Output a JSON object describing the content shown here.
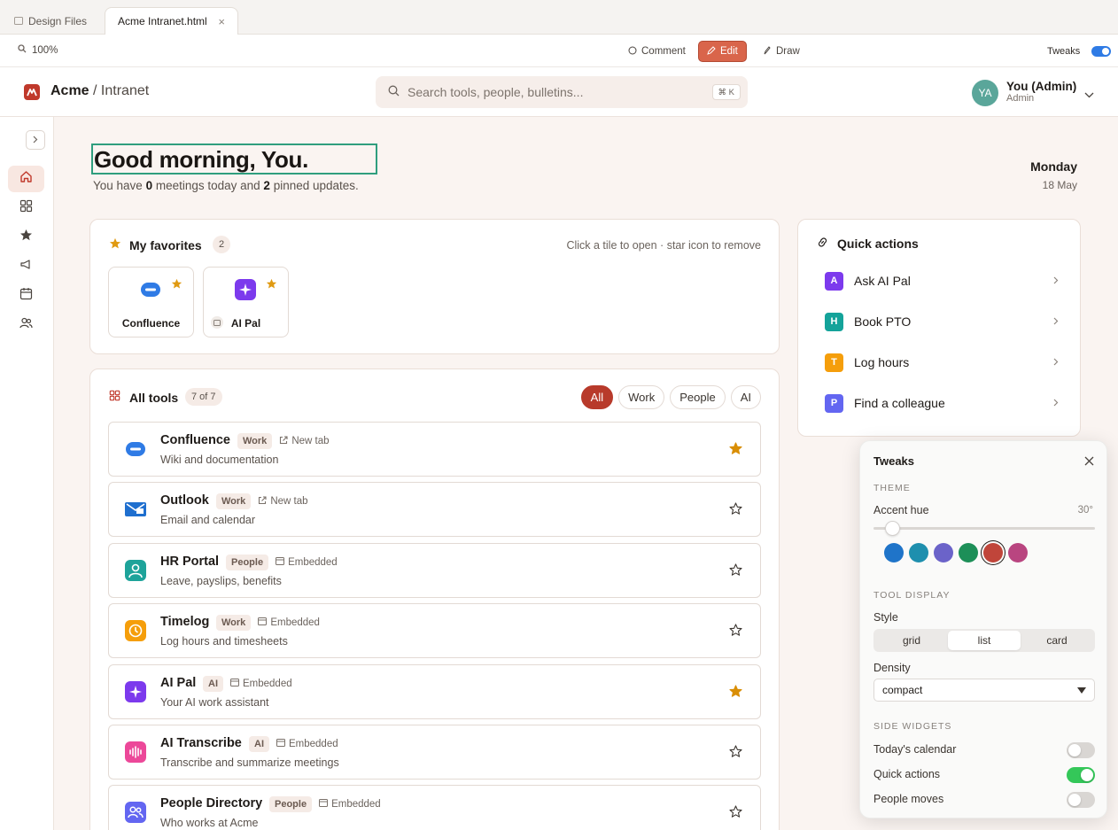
{
  "browser": {
    "tabs": [
      {
        "label": "Design Files"
      },
      {
        "label": "Acme Intranet.html"
      }
    ],
    "zoom": "100%",
    "toolbar": {
      "comment": "Comment",
      "edit": "Edit",
      "draw": "Draw",
      "tweaks": "Tweaks",
      "tweaks_on": true
    }
  },
  "header": {
    "brand": "Acme",
    "brand_sub": "/ Intranet",
    "search_placeholder": "Search tools, people, bulletins...",
    "search_shortcut": "⌘ K",
    "user": {
      "initials": "YA",
      "name": "You (Admin)",
      "role": "Admin"
    }
  },
  "greeting": {
    "title": "Good morning, You.",
    "sub_pre": "You have ",
    "meetings": "0",
    "sub_mid": " meetings today and ",
    "pinned": "2",
    "sub_post": " pinned updates.",
    "day": "Monday",
    "date": "18 May"
  },
  "favorites": {
    "title": "My favorites",
    "count": "2",
    "hint": "Click a tile to open · star icon to remove",
    "items": [
      {
        "label": "Confluence",
        "icon": "confluence-icon"
      },
      {
        "label": "AI Pal",
        "icon": "sparkle-icon"
      }
    ]
  },
  "tools": {
    "title": "All tools",
    "count": "7 of 7",
    "filters": [
      "All",
      "Work",
      "People",
      "AI"
    ],
    "active_filter": "All",
    "rows": [
      {
        "name": "Confluence",
        "tag": "Work",
        "mode": "New tab",
        "desc": "Wiki and documentation",
        "starred": true,
        "color": "#2f7be5"
      },
      {
        "name": "Outlook",
        "tag": "Work",
        "mode": "New tab",
        "desc": "Email and calendar",
        "starred": false,
        "color": "#1f6fcf"
      },
      {
        "name": "HR Portal",
        "tag": "People",
        "mode": "Embedded",
        "desc": "Leave, payslips, benefits",
        "starred": false,
        "color": "#1ea39a"
      },
      {
        "name": "Timelog",
        "tag": "Work",
        "mode": "Embedded",
        "desc": "Log hours and timesheets",
        "starred": false,
        "color": "#f59e0b"
      },
      {
        "name": "AI Pal",
        "tag": "AI",
        "mode": "Embedded",
        "desc": "Your AI work assistant",
        "starred": true,
        "color": "#7c3aed"
      },
      {
        "name": "AI Transcribe",
        "tag": "AI",
        "mode": "Embedded",
        "desc": "Transcribe and summarize meetings",
        "starred": false,
        "color": "#ec4899"
      },
      {
        "name": "People Directory",
        "tag": "People",
        "mode": "Embedded",
        "desc": "Who works at Acme",
        "starred": false,
        "color": "#6366f1"
      }
    ]
  },
  "quick_actions": {
    "title": "Quick actions",
    "items": [
      {
        "letter": "A",
        "label": "Ask AI Pal",
        "color": "#7c3aed"
      },
      {
        "letter": "H",
        "label": "Book PTO",
        "color": "#14a39a"
      },
      {
        "letter": "T",
        "label": "Log hours",
        "color": "#f59e0b"
      },
      {
        "letter": "P",
        "label": "Find a colleague",
        "color": "#6366f1"
      }
    ]
  },
  "tweaks_panel": {
    "title": "Tweaks",
    "theme_heading": "THEME",
    "accent_label": "Accent hue",
    "accent_value": "30°",
    "accent_hue_degrees": 30,
    "swatches": [
      "#1f74c9",
      "#1e8fae",
      "#6b63c9",
      "#1d8f58",
      "#c0453a",
      "#b94580"
    ],
    "selected_swatch": 4,
    "tool_display_heading": "TOOL DISPLAY",
    "style_label": "Style",
    "styles": [
      "grid",
      "list",
      "card"
    ],
    "selected_style": "list",
    "density_label": "Density",
    "density_value": "compact",
    "side_widgets_heading": "SIDE WIDGETS",
    "widgets": [
      {
        "label": "Today's calendar",
        "on": false
      },
      {
        "label": "Quick actions",
        "on": true
      },
      {
        "label": "People moves",
        "on": false
      }
    ]
  }
}
